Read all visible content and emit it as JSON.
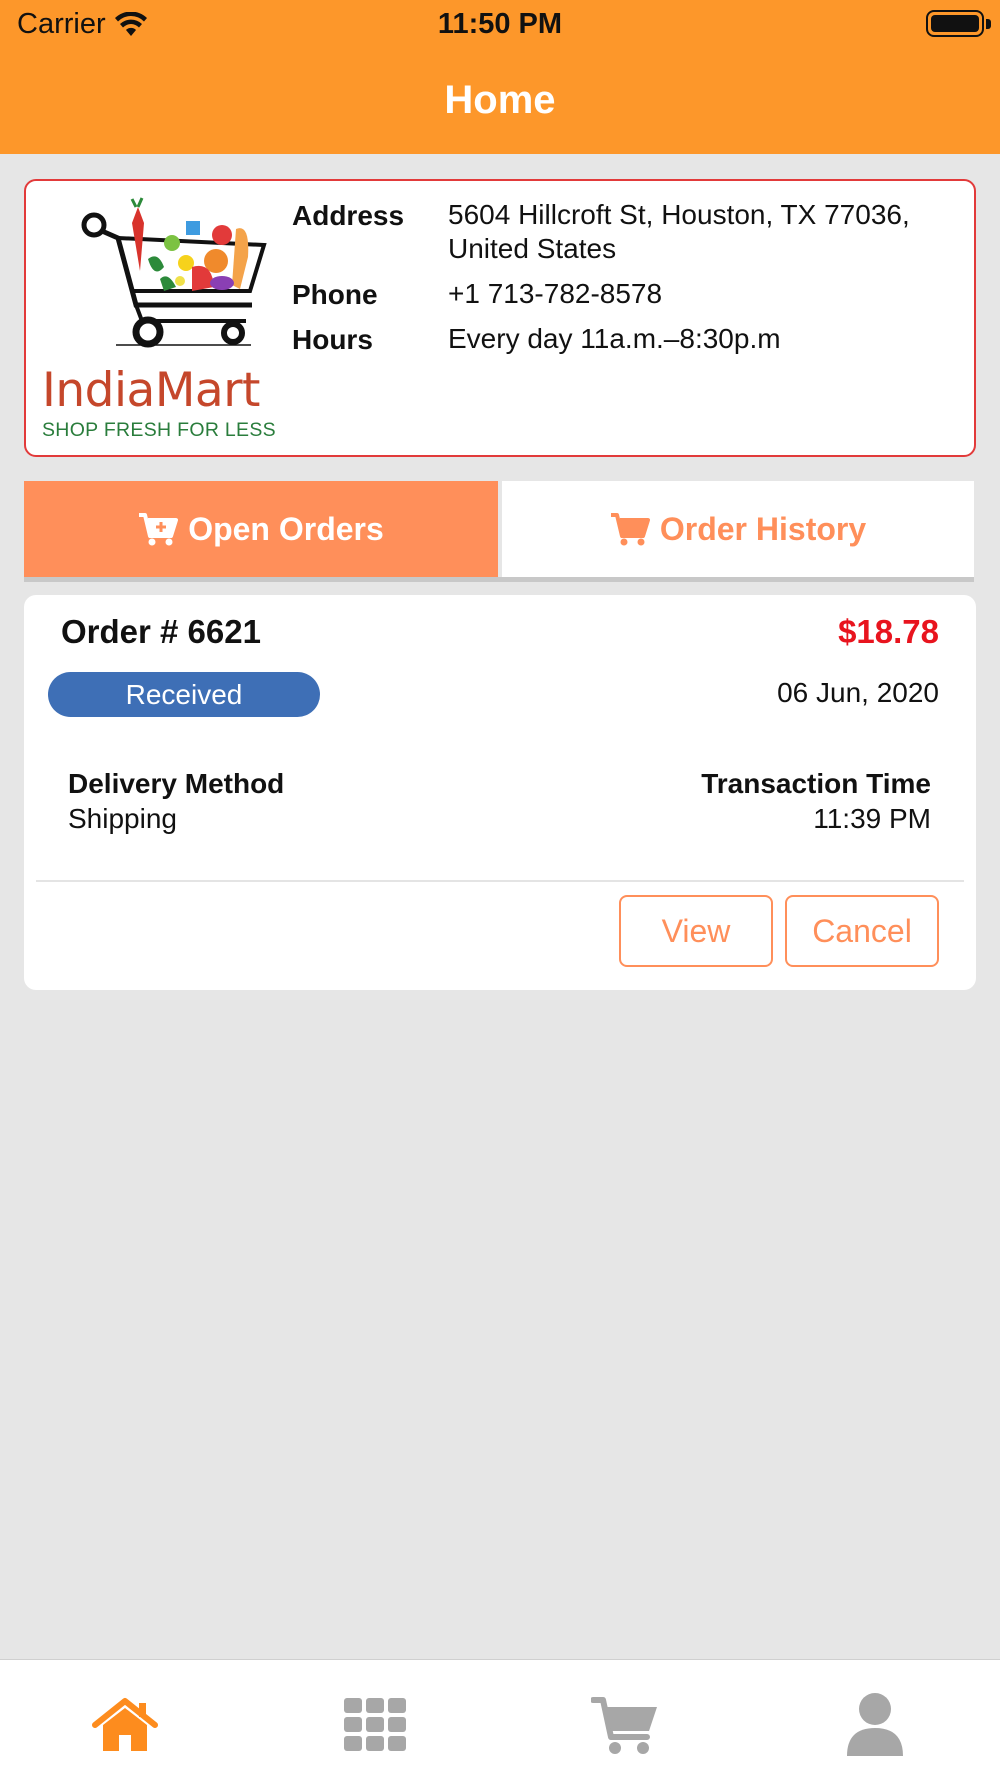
{
  "status_bar": {
    "carrier": "Carrier",
    "time": "11:50 PM"
  },
  "header": {
    "title": "Home"
  },
  "store": {
    "logo_name": "IndiaMart",
    "logo_tagline": "SHOP FRESH FOR LESS",
    "address_label": "Address",
    "address": "5604 Hillcroft St, Houston, TX 77036, United States",
    "phone_label": "Phone",
    "phone": "+1 713-782-8578",
    "hours_label": "Hours",
    "hours": "Every day 11a.m.–8:30p.m"
  },
  "tabs": {
    "open_orders": "Open Orders",
    "order_history": "Order History",
    "active": "open_orders"
  },
  "order": {
    "number_label": "Order # 6621",
    "total": "$18.78",
    "status": "Received",
    "date": "06 Jun, 2020",
    "delivery_method_label": "Delivery Method",
    "delivery_method": "Shipping",
    "transaction_time_label": "Transaction Time",
    "transaction_time": "11:39 PM",
    "view_label": "View",
    "cancel_label": "Cancel"
  },
  "bottom_nav": {
    "items": [
      "home-icon",
      "grid-icon",
      "cart-icon",
      "profile-icon"
    ],
    "active": "home-icon"
  },
  "colors": {
    "header": "#fd972a",
    "accent": "#ff8f5a",
    "total": "#e8141e",
    "status_badge": "#3e6fb6",
    "card_border": "#e23a3a",
    "nav_active": "#fd8c1e",
    "nav_inactive": "#a7a7a7"
  }
}
